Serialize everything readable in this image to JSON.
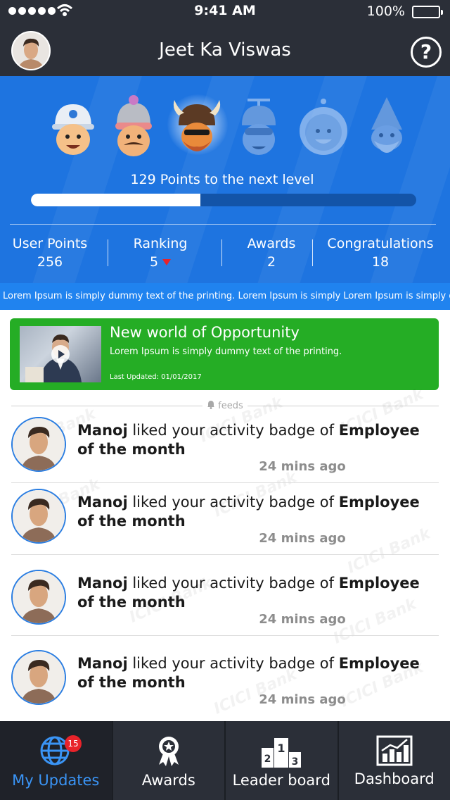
{
  "status": {
    "time": "9:41 AM",
    "battery": "100%"
  },
  "header": {
    "title": "Jeet Ka Viswas",
    "help_symbol": "?"
  },
  "level": {
    "next_level_text": "129 Points to the next level",
    "progress_fraction": 0.44,
    "current_level_index": 2,
    "level_icons": [
      "level-1-cap-face-icon",
      "level-2-beanie-face-icon",
      "level-3-viking-face-icon",
      "level-4-propeller-face-icon",
      "level-5-helmet-face-icon",
      "level-6-wizard-face-icon"
    ]
  },
  "stats": [
    {
      "label": "User Points",
      "value": "256"
    },
    {
      "label": "Ranking",
      "value": "5"
    },
    {
      "label": "Awards",
      "value": "2"
    },
    {
      "label": "Congratulations",
      "value": "18"
    }
  ],
  "ticker": {
    "text": "Lorem Ipsum is simply dummy text of the printing. Lorem Ipsum is simply  Lorem Ipsum is simply d"
  },
  "banner": {
    "title": "New world of Opportunity",
    "text": "Lorem Ipsum is simply dummy text of the printing.",
    "updated": "Last Updated: 01/01/2017"
  },
  "feeds": {
    "label": "feeds",
    "watermark": "ICICI Bank",
    "items": [
      {
        "user": "Manoj",
        "action": " liked your activity badge of ",
        "badge_line1": "Employee",
        "badge_line2": "of the month",
        "time": "24 mins ago"
      },
      {
        "user": "Manoj",
        "action": " liked your activity badge of ",
        "badge_line1": "Employee",
        "badge_line2": "of the month",
        "time": "24 mins ago"
      },
      {
        "user": "Manoj",
        "action": " liked your activity badge of ",
        "badge_line1": "Employee",
        "badge_line2": "of the month",
        "time": "24 mins ago"
      },
      {
        "user": "Manoj",
        "action": " liked your activity badge of ",
        "badge_line1": "Employee",
        "badge_line2": "of the month",
        "time": "24 mins ago"
      }
    ]
  },
  "nav": {
    "items": [
      {
        "label": "My Updates",
        "icon": "globe-icon",
        "badge": "15"
      },
      {
        "label": "Awards",
        "icon": "award-ribbon-icon"
      },
      {
        "label": "Leader board",
        "icon": "podium-icon"
      },
      {
        "label": "Dashboard",
        "icon": "bar-chart-icon"
      }
    ]
  },
  "colors": {
    "accent_blue": "#1e74e0",
    "banner_green": "#25ad25",
    "dark_bg": "#2b2f38",
    "active_tab": "#3a94f5",
    "badge_red": "#e8232a"
  }
}
